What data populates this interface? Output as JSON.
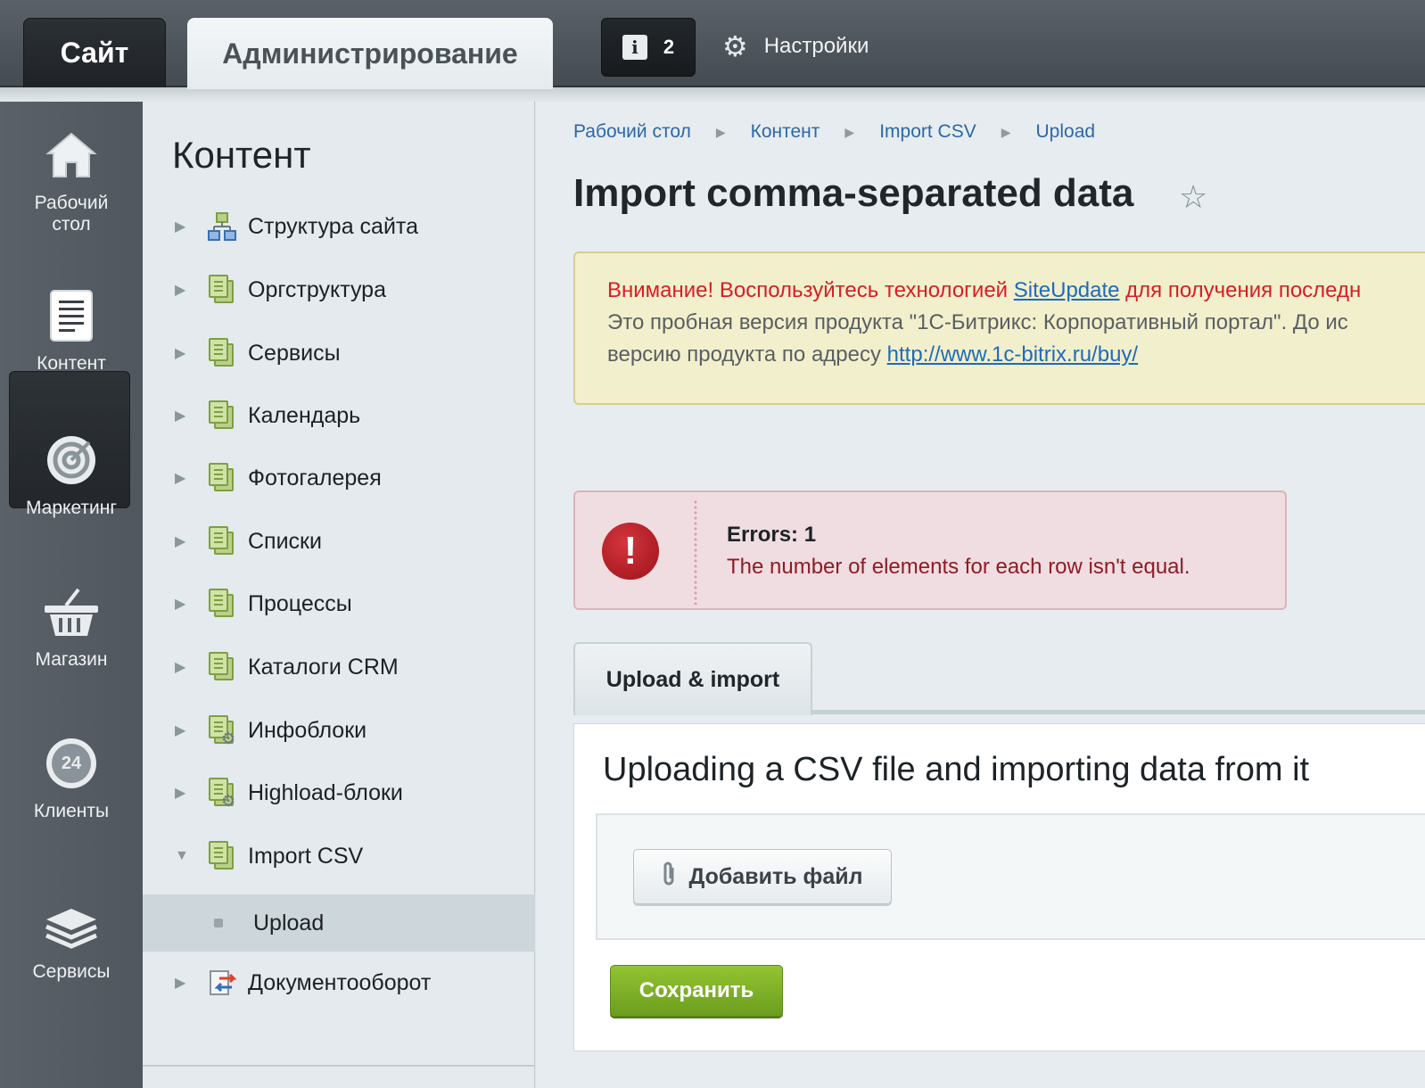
{
  "topbar": {
    "tab_site": "Сайт",
    "tab_admin": "Администрирование",
    "notifications_count": "2",
    "settings_label": "Настройки"
  },
  "rail": {
    "items": [
      {
        "label": "Рабочий стол",
        "icon": "home-icon"
      },
      {
        "label": "Контент",
        "icon": "document-icon",
        "active": true
      },
      {
        "label": "Маркетинг",
        "icon": "target-icon"
      },
      {
        "label": "Магазин",
        "icon": "basket-icon"
      },
      {
        "label": "Клиенты",
        "icon": "clients-24-icon",
        "badge": "24"
      },
      {
        "label": "Сервисы",
        "icon": "layers-icon"
      }
    ]
  },
  "menu": {
    "title": "Контент",
    "items": [
      {
        "label": "Структура сайта",
        "icon": "site-structure-icon"
      },
      {
        "label": "Оргструктура",
        "icon": "page-icon"
      },
      {
        "label": "Сервисы",
        "icon": "page-icon"
      },
      {
        "label": "Календарь",
        "icon": "page-icon"
      },
      {
        "label": "Фотогалерея",
        "icon": "page-icon"
      },
      {
        "label": "Списки",
        "icon": "page-icon"
      },
      {
        "label": "Процессы",
        "icon": "page-icon"
      },
      {
        "label": "Каталоги CRM",
        "icon": "page-icon"
      },
      {
        "label": "Инфоблоки",
        "icon": "page-gear-icon"
      },
      {
        "label": "Highload-блоки",
        "icon": "page-gear-icon"
      },
      {
        "label": "Import CSV",
        "icon": "page-icon",
        "expanded": true
      },
      {
        "label": "Upload",
        "sub": true,
        "active": true
      },
      {
        "label": "Документооборот",
        "icon": "docflow-icon"
      }
    ]
  },
  "breadcrumbs": [
    "Рабочий стол",
    "Контент",
    "Import CSV",
    "Upload"
  ],
  "page_title": "Import comma-separated data",
  "warning": {
    "line1_red_a": "Внимание! Воспользуйтесь технологией ",
    "line1_link": "SiteUpdate",
    "line1_red_b": " для получения последн",
    "line2": "Это пробная версия продукта \"1С-Битрикс: Корпоративный портал\". До ис",
    "line3_text": "версию продукта по адресу ",
    "line3_link": "http://www.1c-bitrix.ru/buy/"
  },
  "error": {
    "title": "Errors: 1",
    "message": "The number of elements for each row isn't equal."
  },
  "tab_upload": "Upload & import",
  "panel_heading": "Uploading a CSV file and importing data from it",
  "add_file_label": "Добавить файл",
  "save_label": "Сохранить",
  "colors": {
    "accent_green": "#7fb027",
    "error_red": "#b81c24",
    "link_blue": "#1d6bbd"
  }
}
